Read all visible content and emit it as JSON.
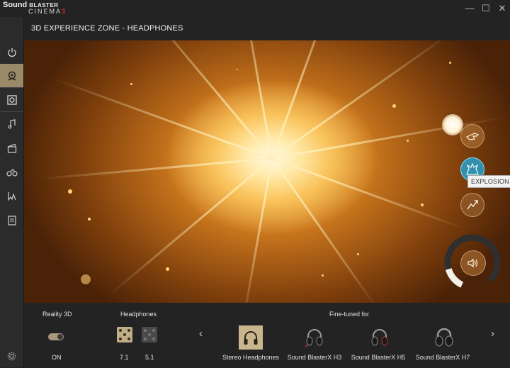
{
  "app": {
    "logo_line1": "Sound",
    "logo_line1_small": "BLASTER",
    "logo_line2": "CINEMA",
    "logo_version": "3"
  },
  "window": {
    "minimize": "—",
    "maximize": "☐",
    "close": "✕"
  },
  "sidebar": {
    "items": [
      {
        "icon": "power-icon",
        "active": false
      },
      {
        "icon": "3d-experience-icon",
        "active": true
      },
      {
        "icon": "speaker-icon",
        "active": false
      },
      {
        "icon": "music-note-icon",
        "active": false
      },
      {
        "icon": "movie-clapper-icon",
        "active": false
      },
      {
        "icon": "gaming-controller-icon",
        "active": false
      },
      {
        "icon": "voice-icon",
        "active": false
      },
      {
        "icon": "profile-list-icon",
        "active": false
      }
    ],
    "settings_icon": "gear-icon"
  },
  "heading": "3D EXPERIENCE ZONE - HEADPHONES",
  "controls": {
    "tooltip": "EXPLOSION",
    "volume_level": 0.78
  },
  "bottom": {
    "reality3d": {
      "label": "Reality 3D",
      "state": "ON"
    },
    "headphones": {
      "label": "Headphones",
      "options": [
        "7.1",
        "5.1"
      ],
      "selected": "7.1"
    },
    "finetuned": {
      "label": "Fine-tuned for",
      "items": [
        "Stereo Headphones",
        "Sound BlasterX H3",
        "Sound BlasterX H5",
        "Sound BlasterX H7"
      ],
      "selected": "Stereo Headphones"
    },
    "prev_arrow": "‹",
    "next_arrow": "›"
  },
  "colors": {
    "accent": "#9b8a67",
    "explosion": "#28a0c8",
    "background": "#232323"
  }
}
